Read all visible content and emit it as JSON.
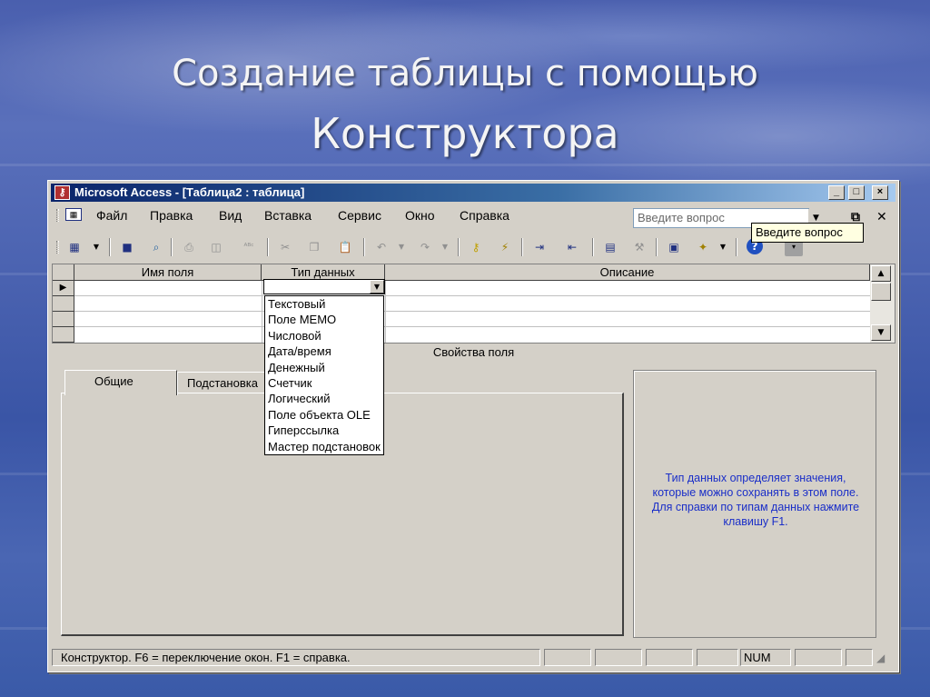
{
  "slide": {
    "title_line1": "Создание таблицы с помощью",
    "title_line2": "Конструктора"
  },
  "window": {
    "title": "Microsoft Access - [Таблица2 : таблица]",
    "controls": [
      "_",
      "□",
      "×"
    ]
  },
  "menu": {
    "items": [
      {
        "label": "Файл"
      },
      {
        "label": "Правка"
      },
      {
        "label": "Вид"
      },
      {
        "label": "Вставка"
      },
      {
        "label": "Сервис"
      },
      {
        "label": "Окно"
      },
      {
        "label": "Справка"
      }
    ],
    "ask_placeholder": "Введите вопрос",
    "tooltip": "Введите вопрос"
  },
  "grid": {
    "columns": [
      "Имя поля",
      "Тип данных",
      "Описание"
    ],
    "section_label": "Свойства поля"
  },
  "datatype_dropdown": {
    "options": [
      "Текстовый",
      "Поле MEMO",
      "Числовой",
      "Дата/время",
      "Денежный",
      "Счетчик",
      "Логический",
      "Поле объекта OLE",
      "Гиперссылка",
      "Мастер подстановок"
    ]
  },
  "properties": {
    "tabs": [
      "Общие",
      "Подстановка"
    ],
    "help_text": "Тип данных определяет значения, которые можно сохранять в этом поле.  Для справки по типам данных нажмите клавишу F1."
  },
  "status": {
    "text": "Конструктор.  F6 = переключение окон.  F1 = справка.",
    "num": "NUM"
  },
  "colors": {
    "titlebar": "#0a246a",
    "help_text": "#1a2ec8",
    "window_bg": "#d4d0c8"
  }
}
